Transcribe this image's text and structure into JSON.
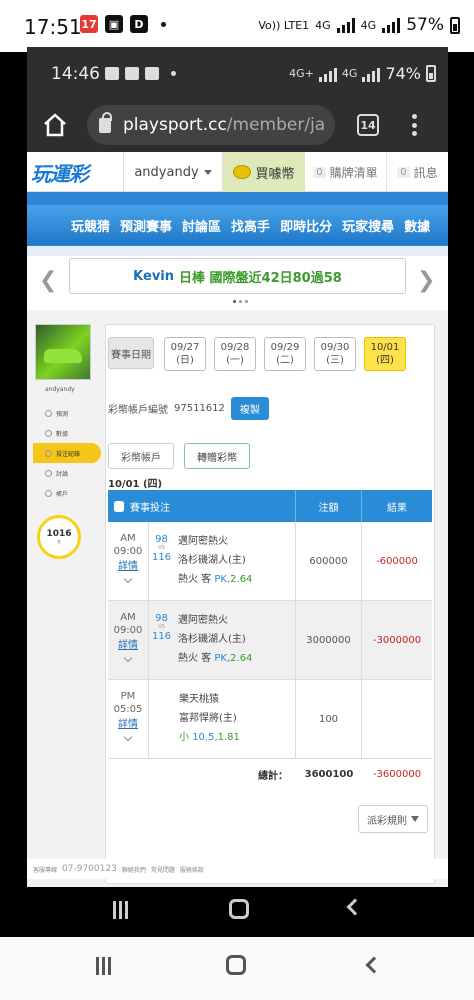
{
  "outer_status": {
    "time": "17:51",
    "volte": "Vo)) LTE1",
    "net1": "4G",
    "net2": "4G",
    "battery": "57%"
  },
  "inner_status": {
    "time": "14:46",
    "net1": "4G+",
    "net2": "4G",
    "battery": "74%"
  },
  "browser": {
    "url_host": "playsport.cc",
    "url_path": "/member/ja",
    "tab_count": "14"
  },
  "site": {
    "logo": "玩運彩",
    "user": "andyandy",
    "buy_coins": "買噱幣",
    "cart_count": "0",
    "cart": "購牌清單",
    "msg_count": "0",
    "msg": "訊息"
  },
  "nav": [
    "玩競猜",
    "預測賽事",
    "討論區",
    "找高手",
    "即時比分",
    "玩家搜尋",
    "數據"
  ],
  "banner": {
    "name": "Kevin",
    "text": "日棒 國際盤近42日80過58"
  },
  "sidebar": {
    "user": "andyandy",
    "items": [
      "預測",
      "數據",
      "投注紀錄",
      "討論",
      "帳戶"
    ],
    "rank_number": "1016",
    "rank_label": "名"
  },
  "dates": {
    "label": "賽事日期",
    "items": [
      {
        "date": "09/27",
        "day": "(日)"
      },
      {
        "date": "09/28",
        "day": "(一)"
      },
      {
        "date": "09/29",
        "day": "(二)"
      },
      {
        "date": "09/30",
        "day": "(三)"
      },
      {
        "date": "10/01",
        "day": "(四)"
      }
    ],
    "active_index": 4
  },
  "account": {
    "label": "彩幣帳戶編號",
    "number": "97511612",
    "copy": "複製"
  },
  "tabs": [
    "彩幣帳戶",
    "轉贈彩幣"
  ],
  "selected_date": "10/01 (四)",
  "table": {
    "headers": [
      "賽事投注",
      "注額",
      "結果"
    ],
    "rows": [
      {
        "ampm": "AM",
        "time": "09:00",
        "detail": "詳情",
        "score_top": "98",
        "vs": "VS",
        "score_bot": "116",
        "team1": "邁阿密熱火",
        "team2": "洛杉磯湖人(主)",
        "pick": "熱火 客",
        "pk": "PK",
        "odds": ",2.64",
        "amount": "600000",
        "result": "-600000"
      },
      {
        "ampm": "AM",
        "time": "09:00",
        "detail": "詳情",
        "score_top": "98",
        "vs": "VS",
        "score_bot": "116",
        "team1": "邁阿密熱火",
        "team2": "洛杉磯湖人(主)",
        "pick": "熱火 客",
        "pk": "PK",
        "odds": ",2.64",
        "amount": "3000000",
        "result": "-3000000"
      },
      {
        "ampm": "PM",
        "time": "05:05",
        "detail": "詳情",
        "team1": "樂天桃猿",
        "team2": "富邦悍將(主)",
        "pick": "小",
        "pk": "10.5",
        "odds": ",1.81",
        "amount": "100",
        "result": ""
      }
    ],
    "total_label": "總計：",
    "total_amount": "3600100",
    "total_result": "-3600000"
  },
  "rules_button": "派彩規則",
  "footer": {
    "hotline": "客服專線",
    "phone": "07-9700123",
    "links": [
      "聯絡我們",
      "常見問題",
      "服務條款"
    ]
  }
}
